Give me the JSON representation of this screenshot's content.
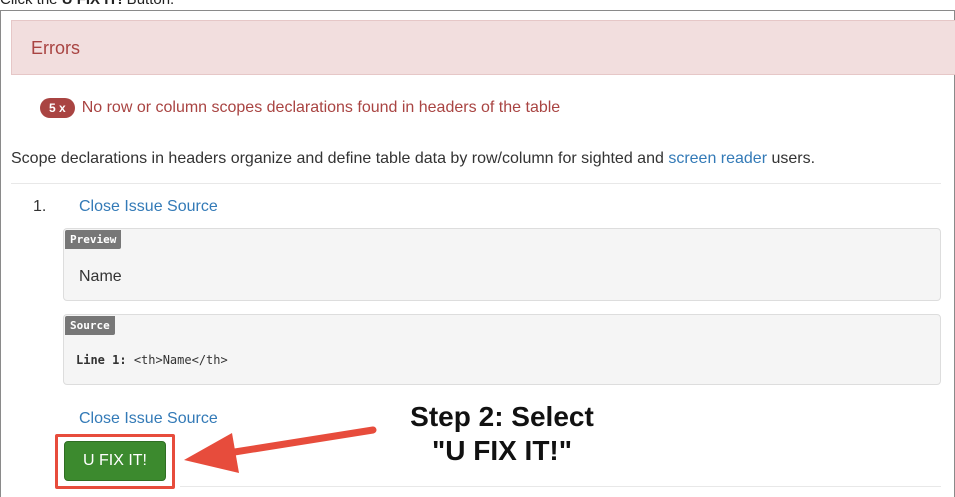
{
  "caption": {
    "prefix": "Click the ",
    "bold": "U FIX IT!",
    "suffix": " Button."
  },
  "errors": {
    "title": "Errors"
  },
  "issue": {
    "count": "5 x",
    "message": "No row or column scopes declarations found in headers of the table"
  },
  "description": {
    "before": "Scope declarations in headers organize and define table data by row/column for sighted and ",
    "link": "screen reader",
    "after": " users."
  },
  "item": {
    "number": "1.",
    "close_link": "Close Issue Source",
    "preview": {
      "label": "Preview",
      "text": "Name"
    },
    "source": {
      "label": "Source",
      "line_prefix": "Line 1:",
      "code": "<th>Name</th>"
    },
    "close_link_bottom": "Close Issue Source",
    "fix_button": "U FIX IT!"
  },
  "annotation": {
    "line1": "Step 2: Select",
    "line2": "\"U FIX IT!\""
  },
  "colors": {
    "error_text": "#a94442",
    "error_bg": "#f2dede",
    "link": "#337ab7",
    "button_green": "#3c8a2e",
    "highlight_red": "#e74c3c"
  },
  "icons": {
    "arrow": "left-arrow-icon"
  }
}
